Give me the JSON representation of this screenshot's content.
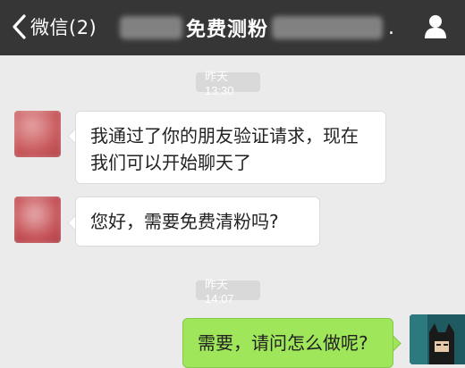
{
  "header": {
    "back_label": "微信(2)",
    "title": "免费测粉",
    "title_suffix": ".",
    "back_icon": "chevron-left-icon",
    "profile_icon": "person-icon"
  },
  "messages": [
    {
      "type": "time",
      "text": "昨天 13:30"
    },
    {
      "type": "incoming",
      "text_line1": "我通过了你的朋友验证请求，现在",
      "text_line2": "我们可以开始聊天了"
    },
    {
      "type": "incoming",
      "text": "您好，需要免费清粉吗?"
    },
    {
      "type": "time",
      "text": "昨天 14:07"
    },
    {
      "type": "outgoing",
      "text": "需要，请问怎么做呢?"
    }
  ],
  "colors": {
    "header_bg": "#363636",
    "chat_bg": "#ebebeb",
    "outgoing_bubble": "#9fe65a",
    "incoming_bubble": "#ffffff",
    "avatar_blur": "#c8565a"
  }
}
